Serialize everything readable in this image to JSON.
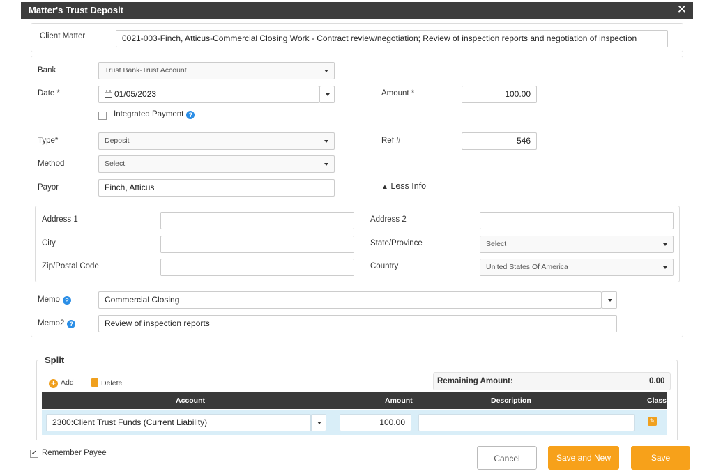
{
  "window": {
    "title": "Matter's Trust Deposit",
    "close_glyph": "✕"
  },
  "client_matter": {
    "label": "Client Matter",
    "value": "0021-003-Finch, Atticus-Commercial Closing Work - Contract review/negotiation;  Review of inspection reports and negotiation of inspection"
  },
  "form": {
    "bank": {
      "label": "Bank",
      "value": "Trust Bank-Trust Account"
    },
    "date": {
      "label": "Date *",
      "value": "01/05/2023"
    },
    "integrated_payment": {
      "label": "Integrated Payment",
      "checked": false
    },
    "amount": {
      "label": "Amount *",
      "value": "100.00"
    },
    "type": {
      "label": "Type*",
      "value": "Deposit"
    },
    "ref": {
      "label": "Ref #",
      "value": "546"
    },
    "method": {
      "label": "Method",
      "value": "Select"
    },
    "payor": {
      "label": "Payor",
      "value": "Finch, Atticus"
    },
    "less_info": {
      "label": "Less Info",
      "glyph": "▲"
    }
  },
  "address": {
    "address1": {
      "label": "Address 1",
      "value": ""
    },
    "address2": {
      "label": "Address 2",
      "value": ""
    },
    "city": {
      "label": "City",
      "value": ""
    },
    "state": {
      "label": "State/Province",
      "value": "Select"
    },
    "zip": {
      "label": "Zip/Postal Code",
      "value": ""
    },
    "country": {
      "label": "Country",
      "value": "United States Of America"
    }
  },
  "memo": {
    "label": "Memo",
    "value": "Commercial Closing"
  },
  "memo2": {
    "label": "Memo2",
    "value": "Review of inspection reports"
  },
  "split": {
    "legend": "Split",
    "add_label": "Add",
    "delete_label": "Delete",
    "remaining_label": "Remaining Amount:",
    "remaining_value": "0.00",
    "columns": {
      "account": "Account",
      "amount": "Amount",
      "description": "Description",
      "class": "Class"
    },
    "rows": [
      {
        "account": "2300:Client Trust Funds (Current Liability)",
        "amount": "100.00",
        "description": ""
      }
    ]
  },
  "footer": {
    "remember_payee": {
      "label": "Remember Payee",
      "checked": true
    },
    "cancel_label": "Cancel",
    "save_new_label": "Save and New",
    "save_label": "Save"
  },
  "colors": {
    "accent": "#f7a11a",
    "titlebar": "#3d3d3d",
    "help": "#2b8ee6",
    "row_highlight": "#d9eef8"
  }
}
